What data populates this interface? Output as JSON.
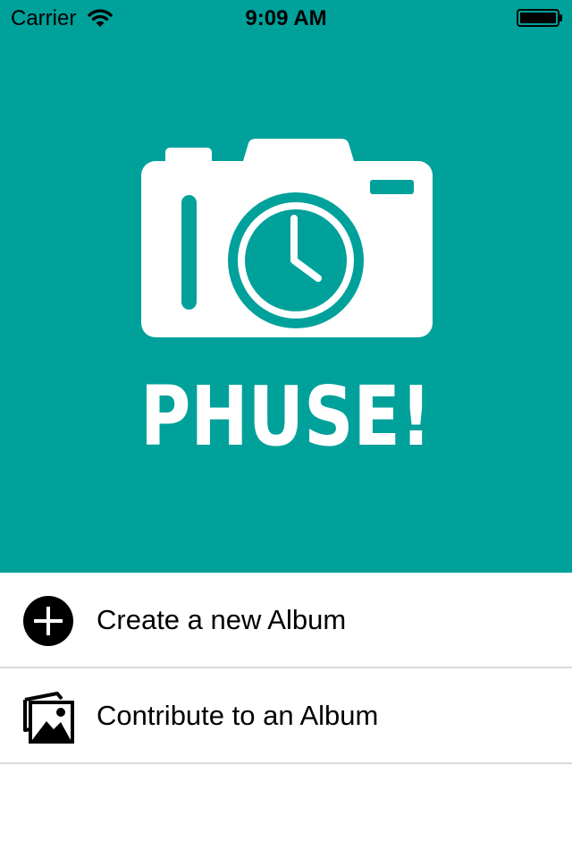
{
  "status_bar": {
    "carrier": "Carrier",
    "time": "9:09 AM"
  },
  "app": {
    "logo_text": "PHUSE!",
    "brand_color": "#00a19a"
  },
  "menu": {
    "items": [
      {
        "label": "Create a new Album",
        "icon": "plus-circle-icon"
      },
      {
        "label": "Contribute to an Album",
        "icon": "photos-stack-icon"
      }
    ]
  }
}
